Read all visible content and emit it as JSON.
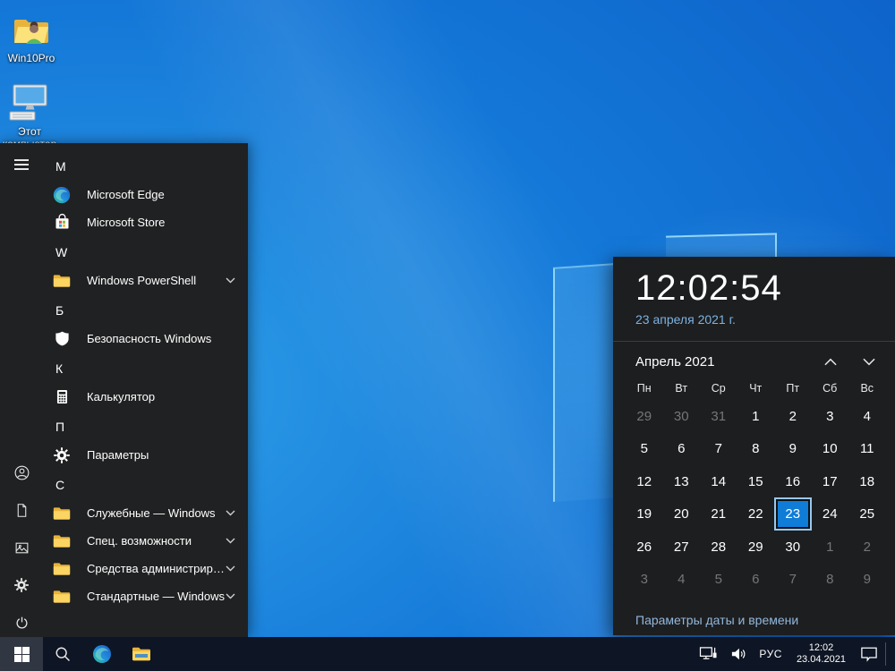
{
  "colors": {
    "accent": "#0078d7",
    "selected_day_fill": "#0f7cd7",
    "taskbar": "#0e1524",
    "menu_bg": "#202122"
  },
  "desktop": {
    "icons": [
      {
        "label": "Win10Pro",
        "icon": "folder-user"
      },
      {
        "label": "Этот компьютер",
        "icon": "this-pc"
      }
    ]
  },
  "start_menu": {
    "rail": [
      {
        "icon": "hamburger"
      },
      {
        "icon": "user"
      },
      {
        "icon": "documents"
      },
      {
        "icon": "pictures"
      },
      {
        "icon": "settings"
      },
      {
        "icon": "power"
      }
    ],
    "sections": [
      {
        "letter": "M",
        "items": [
          {
            "label": "Microsoft Edge",
            "icon": "edge",
            "expand": false
          },
          {
            "label": "Microsoft Store",
            "icon": "store",
            "expand": false
          }
        ]
      },
      {
        "letter": "W",
        "items": [
          {
            "label": "Windows PowerShell",
            "icon": "folder",
            "expand": true
          }
        ]
      },
      {
        "letter": "Б",
        "items": [
          {
            "label": "Безопасность Windows",
            "icon": "shield",
            "expand": false
          }
        ]
      },
      {
        "letter": "К",
        "items": [
          {
            "label": "Калькулятор",
            "icon": "calculator",
            "expand": false
          }
        ]
      },
      {
        "letter": "П",
        "items": [
          {
            "label": "Параметры",
            "icon": "gear",
            "expand": false
          }
        ]
      },
      {
        "letter": "С",
        "items": [
          {
            "label": "Служебные — Windows",
            "icon": "folder",
            "expand": true
          },
          {
            "label": "Спец. возможности",
            "icon": "folder",
            "expand": true
          },
          {
            "label": "Средства администрирования W…",
            "icon": "folder",
            "expand": true
          },
          {
            "label": "Стандартные — Windows",
            "icon": "folder",
            "expand": true
          }
        ]
      }
    ]
  },
  "clock_flyout": {
    "time": "12:02:54",
    "date_link": "23 апреля 2021 г.",
    "month_header": "Апрель 2021",
    "weekdays": [
      "Пн",
      "Вт",
      "Ср",
      "Чт",
      "Пт",
      "Сб",
      "Вс"
    ],
    "weeks": [
      [
        {
          "d": "29",
          "dim": true
        },
        {
          "d": "30",
          "dim": true
        },
        {
          "d": "31",
          "dim": true
        },
        {
          "d": "1"
        },
        {
          "d": "2"
        },
        {
          "d": "3"
        },
        {
          "d": "4"
        }
      ],
      [
        {
          "d": "5"
        },
        {
          "d": "6"
        },
        {
          "d": "7"
        },
        {
          "d": "8"
        },
        {
          "d": "9"
        },
        {
          "d": "10"
        },
        {
          "d": "11"
        }
      ],
      [
        {
          "d": "12"
        },
        {
          "d": "13"
        },
        {
          "d": "14"
        },
        {
          "d": "15"
        },
        {
          "d": "16"
        },
        {
          "d": "17"
        },
        {
          "d": "18"
        }
      ],
      [
        {
          "d": "19"
        },
        {
          "d": "20"
        },
        {
          "d": "21"
        },
        {
          "d": "22"
        },
        {
          "d": "23",
          "sel": true
        },
        {
          "d": "24"
        },
        {
          "d": "25"
        }
      ],
      [
        {
          "d": "26"
        },
        {
          "d": "27"
        },
        {
          "d": "28"
        },
        {
          "d": "29"
        },
        {
          "d": "30"
        },
        {
          "d": "1",
          "dim": true
        },
        {
          "d": "2",
          "dim": true
        }
      ],
      [
        {
          "d": "3",
          "dim": true
        },
        {
          "d": "4",
          "dim": true
        },
        {
          "d": "5",
          "dim": true
        },
        {
          "d": "6",
          "dim": true
        },
        {
          "d": "7",
          "dim": true
        },
        {
          "d": "8",
          "dim": true
        },
        {
          "d": "9",
          "dim": true
        }
      ]
    ],
    "selected_day": "23",
    "footer_link": "Параметры даты и времени"
  },
  "taskbar": {
    "buttons": [
      {
        "icon": "start"
      },
      {
        "icon": "search"
      },
      {
        "icon": "edge"
      },
      {
        "icon": "file-explorer"
      }
    ],
    "tray": {
      "icons": [
        "network",
        "speaker"
      ],
      "language": "РУС",
      "time": "12:02",
      "date": "23.04.2021"
    }
  }
}
